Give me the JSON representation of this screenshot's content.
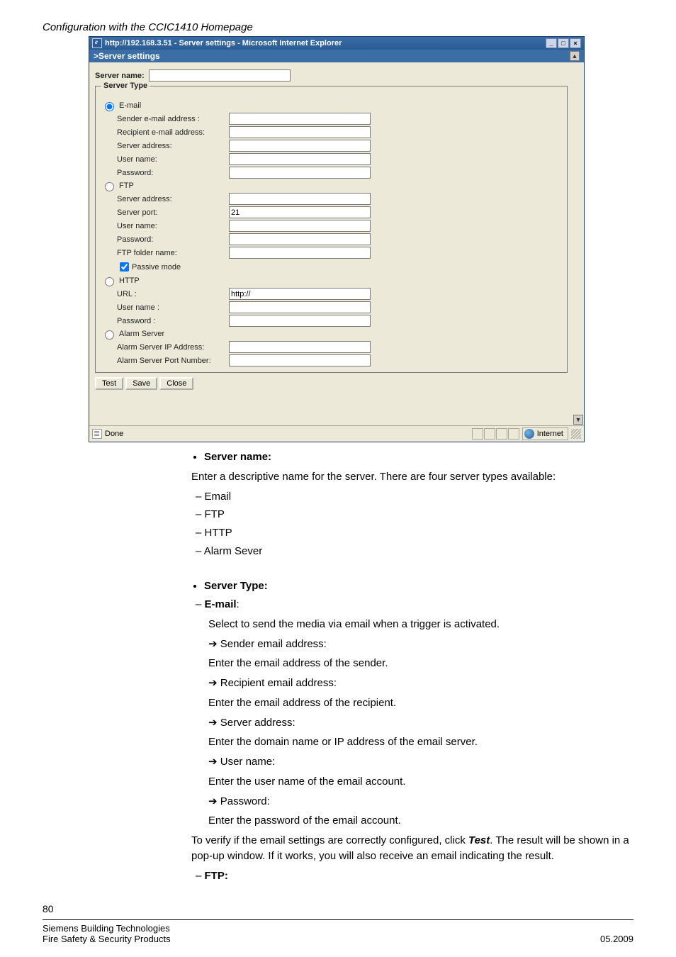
{
  "header": "Configuration with the CCIC1410 Homepage",
  "ie": {
    "titlebar": "http://192.168.3.51 - Server settings - Microsoft Internet Explorer",
    "app_title": ">Server settings",
    "server_name_label": "Server name:",
    "fieldset_legend": "Server Type",
    "email": {
      "opt": "E-mail",
      "sender": "Sender e-mail address :",
      "recipient": "Recipient e-mail address:",
      "server": "Server address:",
      "user": "User name:",
      "pass": "Password:"
    },
    "ftp": {
      "opt": "FTP",
      "server": "Server address:",
      "port": "Server port:",
      "port_val": "21",
      "user": "User name:",
      "pass": "Password:",
      "folder": "FTP folder name:",
      "passive": "Passive mode"
    },
    "http": {
      "opt": "HTTP",
      "url": "URL :",
      "url_val": "http://",
      "user": "User name :",
      "pass": "Password :"
    },
    "alarm": {
      "opt": "Alarm Server",
      "ip": "Alarm Server IP Address:",
      "port": "Alarm Server Port Number:"
    },
    "btn_test": "Test",
    "btn_save": "Save",
    "btn_close": "Close",
    "status_done": "Done",
    "status_zone": "Internet"
  },
  "doc": {
    "servername_h": "Server name:",
    "servername_p": "Enter a descriptive name for the server. There are four server types available:",
    "types": [
      "Email",
      "FTP",
      "HTTP",
      "Alarm Sever"
    ],
    "servertype_h": "Server Type:",
    "email_h": "E-mail",
    "email_p": "Select to send the media via email when a trigger is activated.",
    "items": {
      "sender_t": "Sender email address:",
      "sender_p": "Enter the email address of the sender.",
      "recip_t": "Recipient email address:",
      "recip_p": "Enter the email address of the recipient.",
      "srv_t": "Server address:",
      "srv_p": "Enter the domain name or IP address of the email server.",
      "user_t": "User name:",
      "user_p": "Enter the user name of the email account.",
      "pass_t": "Password:",
      "pass_p": "Enter the password of the email account."
    },
    "verify_p1": "To verify if the email settings are correctly configured, click ",
    "verify_test": "Test",
    "verify_p2": ". The result will be shown in a pop-up window. If it works, you will also receive an email indicating the result.",
    "ftp_h": "FTP:"
  },
  "page_number": "80",
  "footer": {
    "l1": "Siemens Building Technologies",
    "l2": "Fire Safety & Security Products",
    "r": "05.2009"
  }
}
